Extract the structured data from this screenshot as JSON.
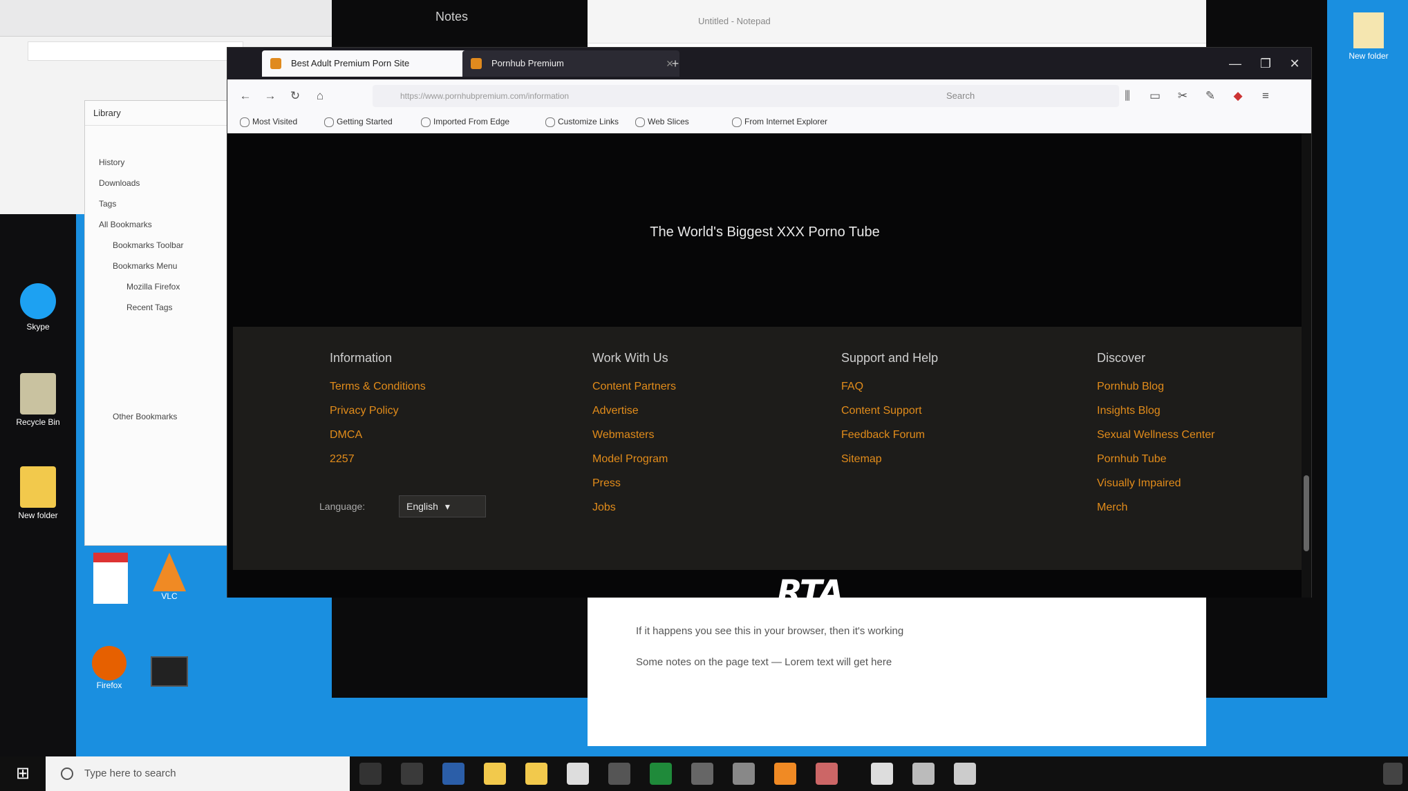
{
  "desktop": {
    "icons": [
      {
        "label": "Skype"
      },
      {
        "label": "Recycle Bin"
      },
      {
        "label": "New folder"
      },
      {
        "label": "Firefox"
      },
      {
        "label": "VLC"
      }
    ],
    "top_right_icon": {
      "label": "New folder"
    }
  },
  "background_windows": {
    "editor_title": "Notes",
    "doc_title": "Untitled - Notepad",
    "doc_lines": [
      "If it happens you see this in your browser, then it's working",
      "Some notes on the page text — Lorem text will get here"
    ]
  },
  "bookmarks_sidebar": {
    "title": "Library",
    "items": [
      "History",
      "Downloads",
      "Tags",
      "All Bookmarks",
      "Bookmarks Toolbar",
      "Bookmarks Menu",
      "Mozilla Firefox",
      "Recent Tags",
      "Other Bookmarks"
    ]
  },
  "firefox": {
    "tabs": [
      {
        "label": "Best Adult Premium Porn Site",
        "active": true
      },
      {
        "label": "Pornhub Premium",
        "active": false
      }
    ],
    "url": "https://www.pornhubpremium.com/information",
    "search_placeholder": "Search",
    "bookmarks": [
      "Most Visited",
      "Getting Started",
      "Imported From Edge",
      "Customize Links",
      "Web Slices",
      "From Internet Explorer"
    ]
  },
  "page": {
    "promo_title": "The World's Biggest XXX Porno Tube",
    "promo_text": "",
    "footer": {
      "columns": [
        {
          "heading": "Information",
          "links": [
            "Terms & Conditions",
            "Privacy Policy",
            "DMCA",
            "2257"
          ]
        },
        {
          "heading": "Work With Us",
          "links": [
            "Content Partners",
            "Advertise",
            "Webmasters",
            "Model Program",
            "Press",
            "Jobs"
          ]
        },
        {
          "heading": "Support and Help",
          "links": [
            "FAQ",
            "Content Support",
            "Feedback Forum",
            "Sitemap"
          ]
        },
        {
          "heading": "Discover",
          "links": [
            "Pornhub Blog",
            "Insights Blog",
            "Sexual Wellness Center",
            "Pornhub Tube",
            "Visually Impaired",
            "Merch"
          ]
        }
      ],
      "language_label": "Language:",
      "language_value": "English"
    },
    "copyright": "",
    "rta_logo": "RTA",
    "partner_logo": "",
    "accent_color": "#e28c1a"
  },
  "taskbar": {
    "search_placeholder": "Type here to search",
    "tray_text": "",
    "clock_time": "",
    "clock_date": ""
  }
}
